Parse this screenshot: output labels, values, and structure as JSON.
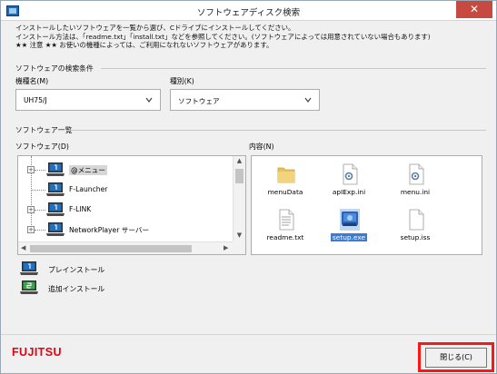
{
  "window": {
    "title": "ソフトウェアディスク検索",
    "close_symbol": "✕"
  },
  "intro": {
    "line1": "インストールしたいソフトウェアを一覧から選び、Cドライブにインストールしてください。",
    "line2": "インストール方法は、「readme.txt」「install.txt」などを参照してください。(ソフトウェアによっては用意されていない場合もあります)",
    "line3": "★★ 注意 ★★ お使いの機種によっては、ご利用になれないソフトウェアがあります。"
  },
  "search": {
    "group_label": "ソフトウェアの検索条件",
    "model_label": "機種名(M)",
    "model_value": "UH75/J",
    "type_label": "種別(K)",
    "type_value": "ソフトウェア"
  },
  "list": {
    "group_label": "ソフトウェア一覧",
    "software_label": "ソフトウェア(D)",
    "content_label": "内容(N)",
    "tree_items": [
      {
        "label": "@メニュー",
        "expander": "+",
        "icon_color": "blue"
      },
      {
        "label": "F-Launcher",
        "expander": "",
        "icon_color": "blue"
      },
      {
        "label": "F-LINK",
        "expander": "+",
        "icon_color": "blue"
      },
      {
        "label": "NetworkPlayer サーバー",
        "expander": "+",
        "icon_color": "blue"
      }
    ],
    "files": [
      {
        "name": "menuData",
        "icon": "folder-icon"
      },
      {
        "name": "apIExp.ini",
        "icon": "ini-file-icon"
      },
      {
        "name": "menu.ini",
        "icon": "ini-file-icon"
      },
      {
        "name": "readme.txt",
        "icon": "text-file-icon"
      },
      {
        "name": "setup.exe",
        "icon": "setup-exe-icon"
      },
      {
        "name": "setup.iss",
        "icon": "blank-file-icon"
      }
    ]
  },
  "legend": {
    "preinstall": "プレインストール",
    "additional": "追加インストール"
  },
  "footer": {
    "logo": "FUJITSU",
    "close_button": "閉じる(C)"
  },
  "colors": {
    "preinstall_icon": "#1e71c2",
    "additional_icon": "#37a84a",
    "highlight": "#ff1515",
    "logo": "#e60012"
  }
}
